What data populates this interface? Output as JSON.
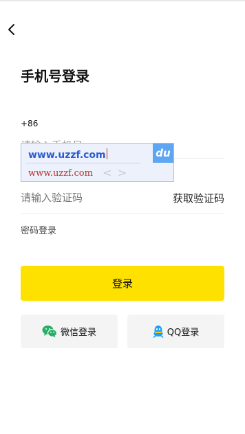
{
  "header": {
    "back_icon": "chevron-left-icon"
  },
  "title": "手机号登录",
  "phone": {
    "country_code": "+86",
    "placeholder": "请输入手机号"
  },
  "ime": {
    "composition": "www.uzzf.com",
    "candidate": "www.uzzf.com",
    "prev_arrow": "<",
    "next_arrow": ">",
    "logo": "du"
  },
  "verification": {
    "placeholder": "请输入验证码",
    "get_code_label": "获取验证码"
  },
  "password_login_label": "密码登录",
  "login_button_label": "登录",
  "social": {
    "wechat_label": "微信登录",
    "qq_label": "QQ登录"
  },
  "colors": {
    "primary": "#ffe100",
    "wechat": "#2aae67",
    "qq": "#1ea0f2",
    "ime_blue": "#2b5bd3",
    "ime_candidate": "#b4322c"
  }
}
